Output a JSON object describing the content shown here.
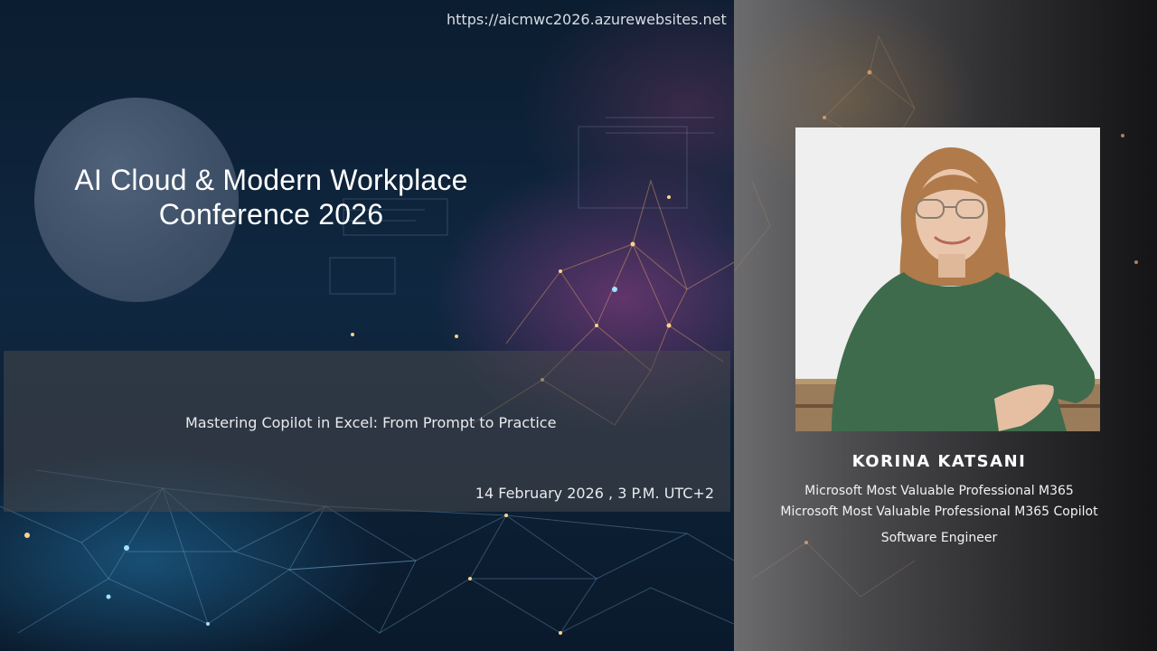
{
  "slide": {
    "url": "https://aicmwc2026.azurewebsites.net",
    "conference_title_line1": "AI Cloud & Modern Workplace",
    "conference_title_line2": "Conference 2026",
    "session_title": "Mastering Copilot in Excel: From Prompt to Practice",
    "session_datetime": "14 February 2026 , 3 P.M. UTC+2"
  },
  "speaker": {
    "name": "KORINA KATSANI",
    "roles": [
      "Microsoft Most Valuable Professional M365",
      "Microsoft Most Valuable Professional M365 Copilot",
      "Software Engineer"
    ]
  },
  "colors": {
    "left_background": "#0f2740",
    "right_background": "#4a4a4d",
    "session_band": "#48484c",
    "text": "#ffffff",
    "sweater": "#3f6b4d",
    "hair": "#b07a4a"
  }
}
